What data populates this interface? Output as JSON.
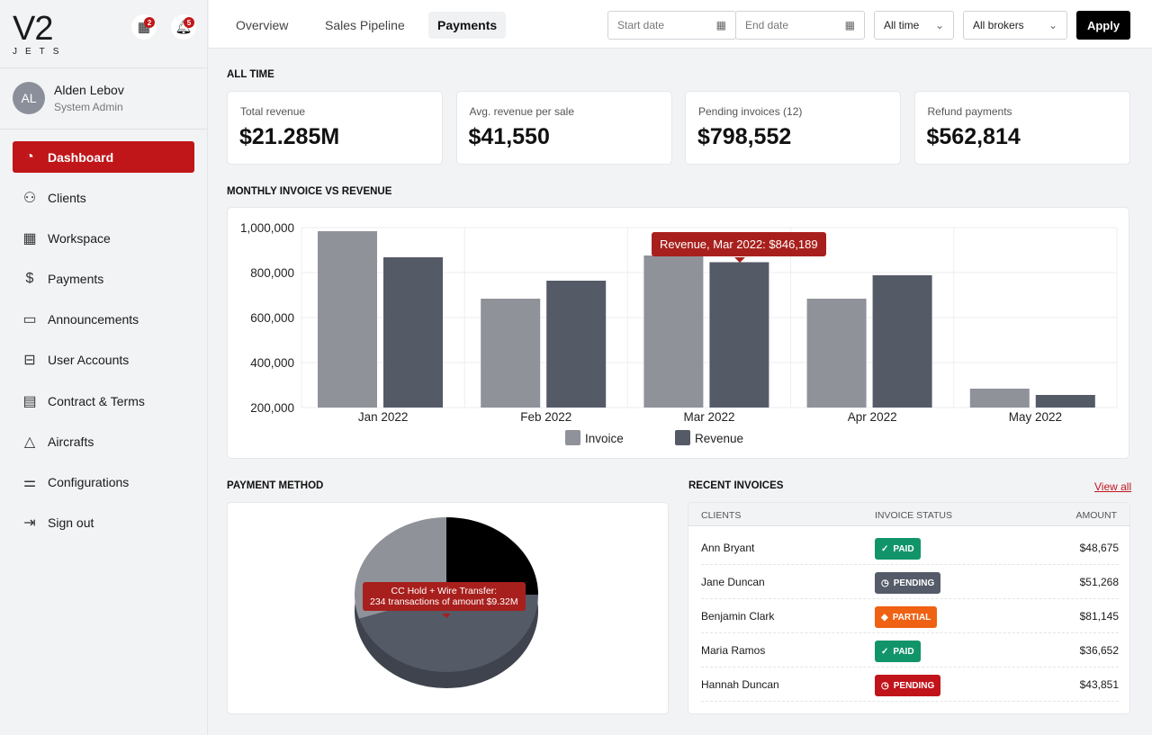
{
  "logo": {
    "main": "V2",
    "sub": "JETS"
  },
  "header_icons": {
    "calendar_count": "2",
    "notifications_count": "5"
  },
  "user": {
    "initials": "AL",
    "name": "Alden Lebov",
    "role": "System Admin"
  },
  "sidebar": {
    "items": [
      {
        "label": "Dashboard",
        "icon": "pie-chart-icon",
        "glyph": "◔",
        "active": true
      },
      {
        "label": "Clients",
        "icon": "user-icon",
        "glyph": "⚇"
      },
      {
        "label": "Workspace",
        "icon": "calendar-icon",
        "glyph": "▦"
      },
      {
        "label": "Payments",
        "icon": "dollar-icon",
        "glyph": "$"
      },
      {
        "label": "Announcements",
        "icon": "chat-icon",
        "glyph": "▭"
      },
      {
        "label": "User Accounts",
        "icon": "briefcase-icon",
        "glyph": "⊟"
      },
      {
        "label": "Contract & Terms",
        "icon": "document-icon",
        "glyph": "▤"
      },
      {
        "label": "Aircrafts",
        "icon": "warning-triangle-icon",
        "glyph": "△"
      },
      {
        "label": "Configurations",
        "icon": "sliders-icon",
        "glyph": "⚌"
      },
      {
        "label": "Sign out",
        "icon": "sign-out-icon",
        "glyph": "⇥"
      }
    ]
  },
  "tabs": [
    {
      "label": "Overview"
    },
    {
      "label": "Sales Pipeline"
    },
    {
      "label": "Payments",
      "active": true
    }
  ],
  "filters": {
    "start_placeholder": "Start date",
    "end_placeholder": "End date",
    "period": "All time",
    "brokers": "All brokers",
    "apply": "Apply"
  },
  "sections": {
    "all_time": "ALL TIME",
    "monthly": "MONTHLY INVOICE VS REVENUE",
    "payment_method": "PAYMENT METHOD",
    "recent": "RECENT INVOICES",
    "view_all": "View all"
  },
  "kpis": [
    {
      "label": "Total revenue",
      "value": "$21.285M"
    },
    {
      "label": "Avg. revenue per sale",
      "value": "$41,550"
    },
    {
      "label": "Pending invoices (12)",
      "value": "$798,552"
    },
    {
      "label": "Refund payments",
      "value": "$562,814"
    }
  ],
  "chart_data": [
    {
      "type": "bar",
      "categories": [
        "Jan 2022",
        "Feb 2022",
        "Mar 2022",
        "Apr 2022",
        "May 2022"
      ],
      "series": [
        {
          "name": "Invoice",
          "color": "#8f9299",
          "values": [
            984000,
            684000,
            876000,
            684000,
            284000
          ]
        },
        {
          "name": "Revenue",
          "color": "#545a66",
          "values": [
            868000,
            764000,
            846189,
            788000,
            256000
          ]
        }
      ],
      "yticks": [
        "1,000,000",
        "800,000",
        "600,000",
        "400,000",
        "200,000"
      ],
      "ylim": [
        200000,
        1000000
      ],
      "legend": "bottom",
      "grid": true,
      "tooltip": "Revenue, Mar 2022: $846,189"
    },
    {
      "type": "pie",
      "slices": [
        {
          "value": 0.25,
          "color": "#000000"
        },
        {
          "value": 0.45,
          "color": "#545a66"
        },
        {
          "value": 0.3,
          "color": "#8f9299"
        }
      ],
      "tooltip_title": "CC Hold + Wire Transfer:",
      "tooltip_body": "234 transactions of amount $9.32M"
    }
  ],
  "invoices": {
    "headers": [
      "CLIENTS",
      "INVOICE STATUS",
      "AMOUNT"
    ],
    "rows": [
      {
        "client": "Ann Bryant",
        "status": "PAID",
        "color": "#12946a",
        "icon": "✓",
        "amount": "$48,675"
      },
      {
        "client": "Jane Duncan",
        "status": "PENDING",
        "color": "#555b68",
        "icon": "◷",
        "amount": "$51,268"
      },
      {
        "client": "Benjamin Clark",
        "status": "PARTIAL",
        "color": "#ef6113",
        "icon": "◆",
        "amount": "$81,145"
      },
      {
        "client": "Maria Ramos",
        "status": "PAID",
        "color": "#12946a",
        "icon": "✓",
        "amount": "$36,652"
      },
      {
        "client": "Hannah Duncan",
        "status": "PENDING",
        "color": "#c0141a",
        "icon": "◷",
        "amount": "$43,851"
      }
    ]
  }
}
